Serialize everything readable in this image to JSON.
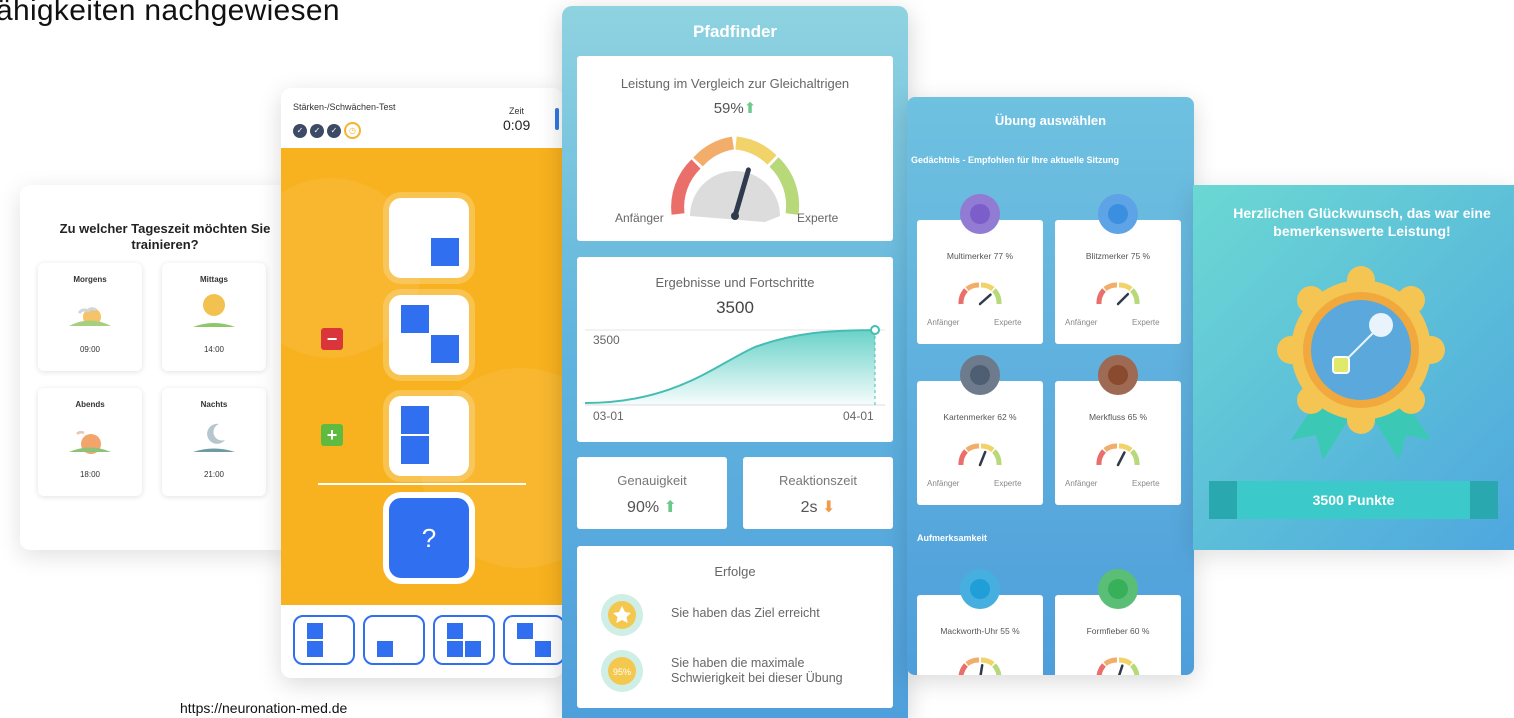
{
  "headline": "ähigkeiten nachgewiesen",
  "source": "https://neuronation-med.de",
  "time_card": {
    "question": "Zu welcher Tageszeit möchten Sie trainieren?",
    "slots": [
      {
        "name": "Morgens",
        "time": "09:00"
      },
      {
        "name": "Mittags",
        "time": "14:00"
      },
      {
        "name": "Abends",
        "time": "18:00"
      },
      {
        "name": "Nachts",
        "time": "21:00"
      }
    ]
  },
  "test_card": {
    "title": "Stärken-/Schwächen-Test",
    "timer_label": "Zeit",
    "timer_value": "0:09",
    "question_mark": "?",
    "minus": "−",
    "plus": "+",
    "accent_color": "#2f6ff0",
    "background_color": "#f8b21f"
  },
  "pathfinder": {
    "title": "Pfadfinder",
    "performance": {
      "title": "Leistung im Vergleich zur Gleichaltrigen",
      "value": "59%",
      "level_fraction": 0.59,
      "min_label": "Anfänger",
      "max_label": "Experte"
    },
    "progress": {
      "title": "Ergebnisse und Fortschritte",
      "value": "3500",
      "y_label": "3500",
      "x_start": "03-01",
      "x_end": "04-01"
    },
    "accuracy": {
      "title": "Genauigkeit",
      "value": "90%"
    },
    "reaction": {
      "title": "Reaktionszeit",
      "value": "2s"
    },
    "achievements": {
      "title": "Erfolge",
      "items": [
        {
          "text": "Sie haben das Ziel erreicht"
        },
        {
          "text": "Sie haben die maximale Schwierigkeit bei dieser Übung",
          "badge": "95%"
        }
      ]
    }
  },
  "exercise_card": {
    "title": "Übung auswählen",
    "section1": "Gedächtnis - Empfohlen für Ihre aktuelle Sitzung",
    "section2": "Aufmerksamkeit",
    "min_label": "Anfänger",
    "max_label": "Experte",
    "exercises": [
      {
        "name": "Multimerker 77 %",
        "level": 0.77,
        "color": "#7b5ec9"
      },
      {
        "name": "Blitzmerker 75 %",
        "level": 0.75,
        "color": "#3b8fe0"
      },
      {
        "name": "Kartenmerker 62 %",
        "level": 0.62,
        "color": "#4e5e73"
      },
      {
        "name": "Merkfluss 65 %",
        "level": 0.65,
        "color": "#8a4a2e"
      },
      {
        "name": "Mackworth-Uhr 55 %",
        "level": 0.55,
        "color": "#1f9ed8"
      },
      {
        "name": "Formfieber 60 %",
        "level": 0.6,
        "color": "#38b05a"
      }
    ]
  },
  "congrats_card": {
    "message": "Herzlichen Glückwunsch, das war eine bemerkenswerte Leistung!",
    "points": "3500 Punkte"
  }
}
